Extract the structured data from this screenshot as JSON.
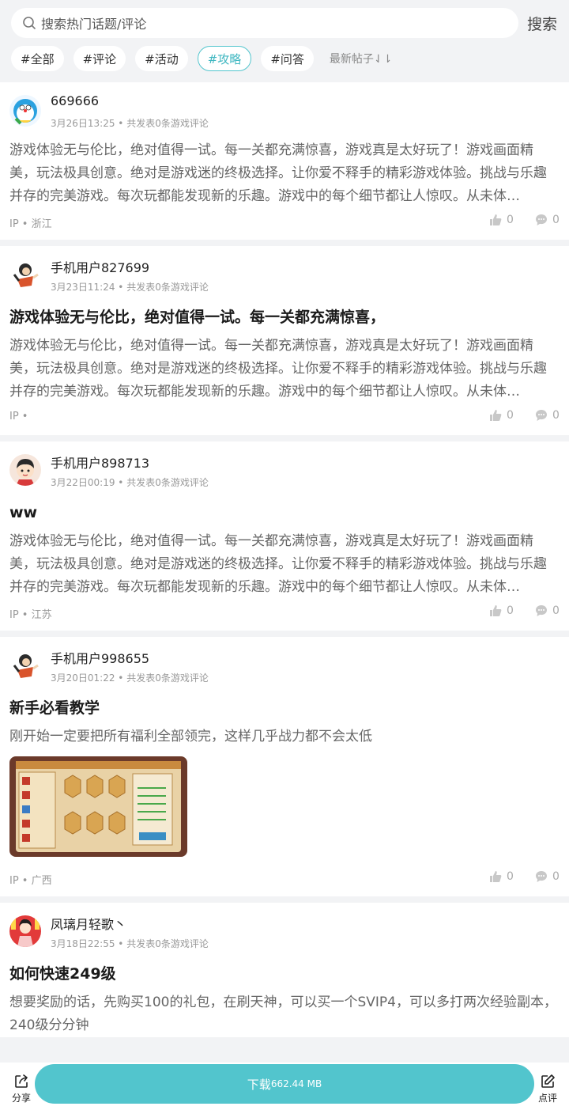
{
  "search": {
    "placeholder": "搜索热门话题/评论",
    "button": "搜索"
  },
  "tags": [
    {
      "label": "#全部",
      "active": false
    },
    {
      "label": "#评论",
      "active": false
    },
    {
      "label": "#活动",
      "active": false
    },
    {
      "label": "#攻略",
      "active": true
    },
    {
      "label": "#问答",
      "active": false
    }
  ],
  "sort_label": "最新帖子⇃⇂",
  "posts": [
    {
      "username": "669666",
      "meta": "3月26日13:25 • 共发表0条游戏评论",
      "title": "",
      "body": "游戏体验无与伦比，绝对值得一试。每一关都充满惊喜，游戏真是太好玩了！游戏画面精美，玩法极具创意。绝对是游戏迷的终极选择。让你爱不释手的精彩游戏体验。挑战与乐趣并存的完美游戏。每次玩都能发现新的乐趣。游戏中的每个细节都让人惊叹。从未体…",
      "ip": "IP • 浙江",
      "likes": "0",
      "comments": "0"
    },
    {
      "username": "手机用户827699",
      "meta": "3月23日11:24 • 共发表0条游戏评论",
      "title": "游戏体验无与伦比，绝对值得一试。每一关都充满惊喜，",
      "body": "游戏体验无与伦比，绝对值得一试。每一关都充满惊喜，游戏真是太好玩了！游戏画面精美，玩法极具创意。绝对是游戏迷的终极选择。让你爱不释手的精彩游戏体验。挑战与乐趣并存的完美游戏。每次玩都能发现新的乐趣。游戏中的每个细节都让人惊叹。从未体…",
      "ip": "IP •",
      "likes": "0",
      "comments": "0"
    },
    {
      "username": "手机用户898713",
      "meta": "3月22日00:19 • 共发表0条游戏评论",
      "title": "ww",
      "body": "游戏体验无与伦比，绝对值得一试。每一关都充满惊喜，游戏真是太好玩了！游戏画面精美，玩法极具创意。绝对是游戏迷的终极选择。让你爱不释手的精彩游戏体验。挑战与乐趣并存的完美游戏。每次玩都能发现新的乐趣。游戏中的每个细节都让人惊叹。从未体…",
      "ip": "IP • 江苏",
      "likes": "0",
      "comments": "0"
    },
    {
      "username": "手机用户998655",
      "meta": "3月20日01:22 • 共发表0条游戏评论",
      "title": "新手必看教学",
      "body": "刚开始一定要把所有福利全部领完，这样几乎战力都不会太低",
      "ip": "IP • 广西",
      "likes": "0",
      "comments": "0"
    },
    {
      "username": "凤璃月轻歌丶",
      "meta": "3月18日22:55 • 共发表0条游戏评论",
      "title": "如何快速249级",
      "body": "想要奖励的话，先购买100的礼包，在刷天神，可以买一个SVIP4，可以多打两次经验副本，240级分分钟"
    }
  ],
  "bottom": {
    "share": "分享",
    "download": "下载",
    "download_size": "662.44 MB",
    "review": "点评"
  },
  "colors": {
    "accent": "#52c5cd",
    "background": "#f2f3f5"
  }
}
